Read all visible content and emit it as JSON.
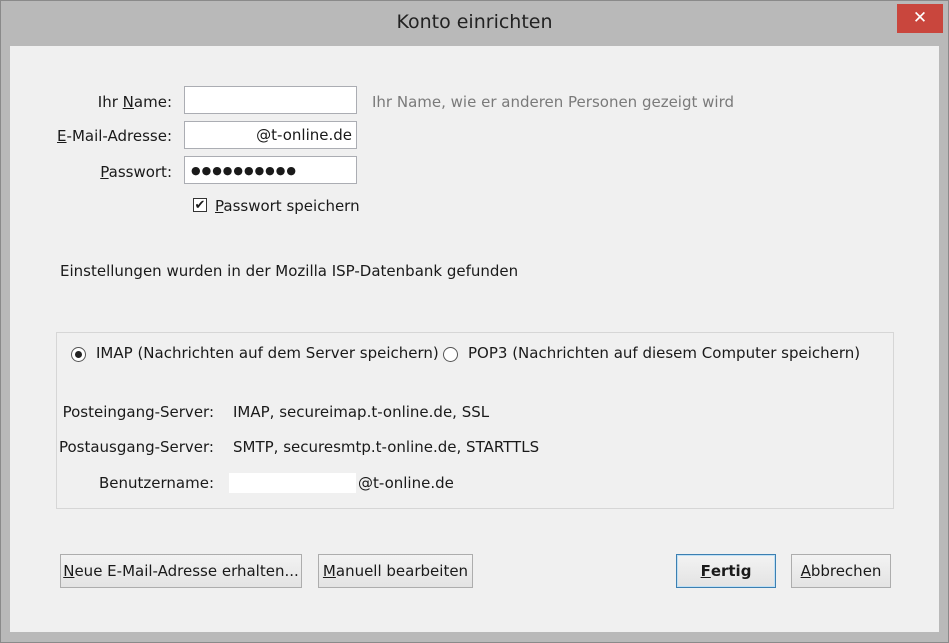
{
  "window": {
    "title": "Konto einrichten",
    "close_glyph": "✕"
  },
  "form": {
    "name_label": {
      "pre": "Ihr ",
      "acc": "N",
      "post": "ame:"
    },
    "name_value": "",
    "name_hint": "Ihr Name, wie er anderen Personen gezeigt wird",
    "email_label": {
      "pre": "",
      "acc": "E",
      "post": "-Mail-Adresse:"
    },
    "email_value": "@t-online.de",
    "password_label": {
      "pre": "",
      "acc": "P",
      "post": "asswort:"
    },
    "password_value": "●●●●●●●●●●",
    "save_password": {
      "pre": "",
      "acc": "P",
      "post": "asswort speichern",
      "checked": true
    }
  },
  "status_text": "Einstellungen wurden in der Mozilla ISP-Datenbank gefunden",
  "protocols": {
    "imap_label": "IMAP (Nachrichten auf dem Server speichern)",
    "imap_selected": true,
    "pop3_label": "POP3 (Nachrichten auf diesem Computer speichern)",
    "pop3_selected": false
  },
  "server_info": {
    "incoming_label": "Posteingang-Server:",
    "incoming_value": "IMAP, secureimap.t-online.de, SSL",
    "outgoing_label": "Postausgang-Server:",
    "outgoing_value": "SMTP, securesmtp.t-online.de, STARTTLS",
    "username_label": "Benutzername:",
    "username_value": "@t-online.de"
  },
  "buttons": {
    "new_address": {
      "pre": "",
      "acc": "N",
      "post": "eue E-Mail-Adresse erhalten..."
    },
    "manual_edit": {
      "pre": "",
      "acc": "M",
      "post": "anuell bearbeiten"
    },
    "done": {
      "pre": "",
      "acc": "F",
      "post": "ertig"
    },
    "cancel": {
      "pre": "",
      "acc": "A",
      "post": "bbrechen"
    }
  },
  "colors": {
    "close_button": "#c9463d",
    "window_frame": "#b9b9b9",
    "client_bg": "#f0f0f0"
  }
}
